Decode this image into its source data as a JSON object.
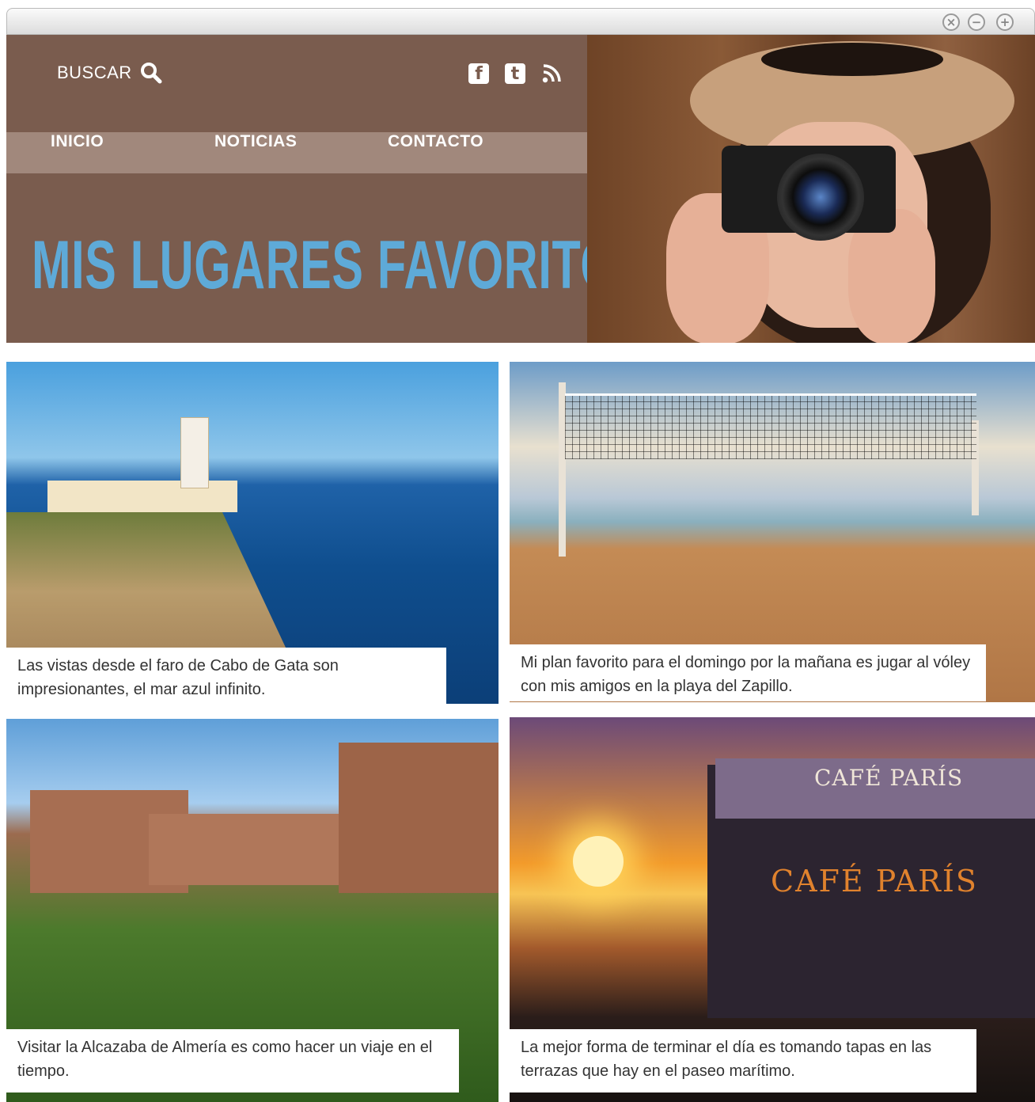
{
  "window": {
    "controls": [
      "close",
      "minimize",
      "maximize"
    ]
  },
  "header": {
    "search_label": "BUSCAR",
    "nav": [
      "INICIO",
      "NOTICIAS",
      "CONTACTO"
    ],
    "title": "MIS LUGARES FAVORITOS",
    "social_icons": [
      "facebook-icon",
      "twitter-icon",
      "rss-icon"
    ]
  },
  "cafe_sign": "CAFÉ PARÍS",
  "cafe_glass": "CAFÉ PARÍS",
  "captions": [
    "Las vistas desde el faro de Cabo de Gata son impresionantes, el mar azul infinito.",
    "Mi plan favorito para el domingo por la mañana es jugar al vóley con mis amigos en la playa del Zapillo.",
    "Visitar la Alcazaba de Almería es como hacer un viaje en el tiempo.",
    "La mejor forma de terminar el día es tomando tapas en las terrazas que hay en el paseo marítimo."
  ],
  "colors": {
    "header_bg": "#7a5c4e",
    "nav_bg": "#a1887c",
    "title": "#5eaad8"
  }
}
